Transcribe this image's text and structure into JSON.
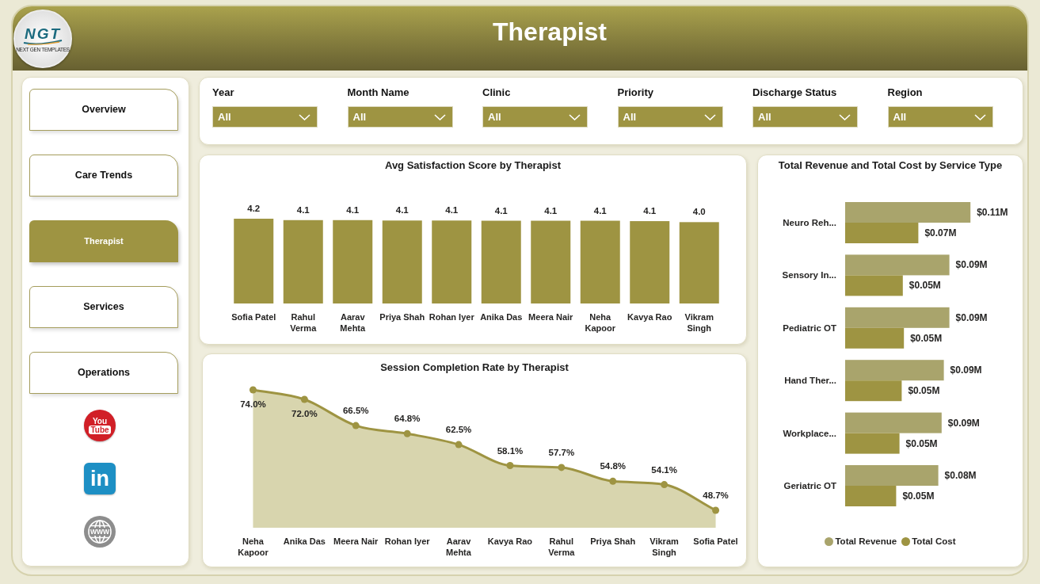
{
  "header": {
    "title": "Therapist",
    "logo": {
      "initials": "NGT",
      "tagline": "NEXT GEN TEMPLATES"
    }
  },
  "sidebar": {
    "nav": [
      {
        "label": "Overview",
        "selected": false
      },
      {
        "label": "Care Trends",
        "selected": false
      },
      {
        "label": "Therapist",
        "selected": true
      },
      {
        "label": "Services",
        "selected": false
      },
      {
        "label": "Operations",
        "selected": false
      }
    ],
    "social_links": [
      {
        "kind": "youtube",
        "text_lines": [
          "You",
          "Tube"
        ]
      },
      {
        "kind": "linkedin",
        "text_lines": [
          "in"
        ]
      },
      {
        "kind": "website",
        "text_lines": [
          "WWW"
        ]
      }
    ]
  },
  "filters": [
    {
      "label": "Year",
      "value": "All"
    },
    {
      "label": "Month Name",
      "value": "All"
    },
    {
      "label": "Clinic",
      "value": "All"
    },
    {
      "label": "Priority",
      "value": "All"
    },
    {
      "label": "Discharge Status",
      "value": "All"
    },
    {
      "label": "Region",
      "value": "All"
    }
  ],
  "satisfaction_chart": {
    "chart_data": {
      "type": "bar",
      "orientation": "vertical",
      "title": "Avg Satisfaction Score by Therapist",
      "categories": [
        "Sofia Patel",
        "Rahul Verma",
        "Aarav Mehta",
        "Priya Shah",
        "Rohan Iyer",
        "Anika Das",
        "Meera Nair",
        "Neha Kapoor",
        "Kavya Rao",
        "Vikram Singh"
      ],
      "values": [
        4.2,
        4.13,
        4.13,
        4.11,
        4.11,
        4.1,
        4.1,
        4.1,
        4.08,
        4.03
      ],
      "value_labels": [
        "4.2",
        "4.1",
        "4.1",
        "4.1",
        "4.1",
        "4.1",
        "4.1",
        "4.1",
        "4.1",
        "4.0"
      ]
    }
  },
  "completion_chart": {
    "chart_data": {
      "type": "area",
      "title": "Session Completion Rate by Therapist",
      "categories": [
        "Neha Kapoor",
        "Anika Das",
        "Meera Nair",
        "Rohan Iyer",
        "Aarav Mehta",
        "Kavya Rao",
        "Rahul Verma",
        "Priya Shah",
        "Vikram Singh",
        "Sofia Patel"
      ],
      "values": [
        74.0,
        72.0,
        66.5,
        64.8,
        62.5,
        58.1,
        57.7,
        54.8,
        54.1,
        48.7
      ],
      "value_labels": [
        "74.0%",
        "72.0%",
        "66.5%",
        "64.8%",
        "62.5%",
        "58.1%",
        "57.7%",
        "54.8%",
        "54.1%",
        "48.7%"
      ]
    }
  },
  "revenue_cost_chart": {
    "chart_data": {
      "type": "bar",
      "orientation": "horizontal",
      "title": "Total Revenue and Total Cost by Service Type",
      "categories": [
        "Neuro Reh...",
        "Sensory In...",
        "Pediatric OT",
        "Hand Ther...",
        "Workplace...",
        "Geriatric OT"
      ],
      "series": [
        {
          "name": "Total Revenue",
          "color": "#a9a46c",
          "values": [
            0.113,
            0.094,
            0.094,
            0.089,
            0.087,
            0.084
          ],
          "value_labels": [
            "$0.11M",
            "$0.09M",
            "$0.09M",
            "$0.09M",
            "$0.09M",
            "$0.08M"
          ]
        },
        {
          "name": "Total Cost",
          "color": "#9e9442",
          "values": [
            0.066,
            0.052,
            0.053,
            0.051,
            0.049,
            0.046
          ],
          "value_labels": [
            "$0.07M",
            "$0.05M",
            "$0.05M",
            "$0.05M",
            "$0.05M",
            "$0.05M"
          ]
        }
      ],
      "legend": "bottom"
    }
  }
}
